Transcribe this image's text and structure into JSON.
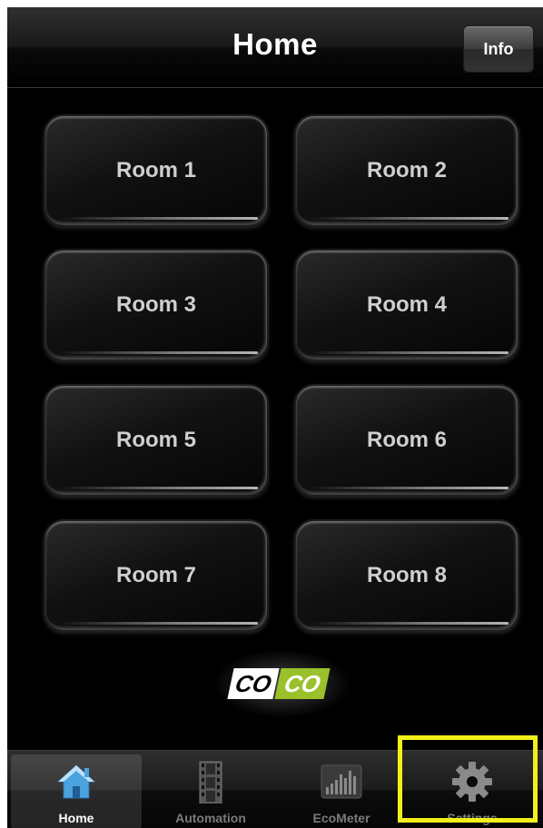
{
  "navbar": {
    "title": "Home",
    "info_label": "Info"
  },
  "rooms": [
    {
      "label": "Room 1"
    },
    {
      "label": "Room 2"
    },
    {
      "label": "Room 3"
    },
    {
      "label": "Room 4"
    },
    {
      "label": "Room 5"
    },
    {
      "label": "Room 6"
    },
    {
      "label": "Room 7"
    },
    {
      "label": "Room 8"
    }
  ],
  "logo": {
    "part1": "CO",
    "part2": "CO",
    "accent_color": "#9ac12c"
  },
  "tabbar": {
    "tabs": [
      {
        "label": "Home",
        "icon": "house-icon",
        "selected": true
      },
      {
        "label": "Automation",
        "icon": "film-strip-icon",
        "selected": false
      },
      {
        "label": "EcoMeter",
        "icon": "bar-meter-icon",
        "selected": false
      },
      {
        "label": "Settings",
        "icon": "gear-icon",
        "selected": false
      }
    ]
  },
  "highlight": {
    "target": "Settings",
    "color": "#f2ef1b"
  }
}
